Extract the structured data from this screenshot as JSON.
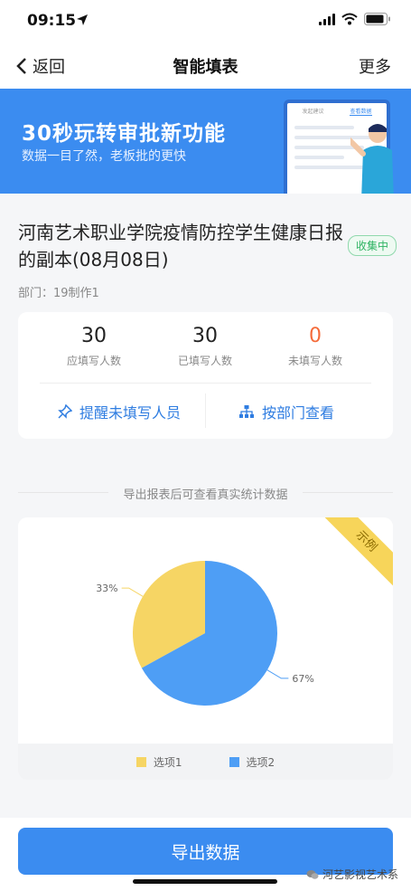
{
  "status": {
    "time": "09:15"
  },
  "nav": {
    "back": "返回",
    "title": "智能填表",
    "more": "更多"
  },
  "banner": {
    "title": "30秒玩转审批新功能",
    "subtitle": "数据一目了然，老板批的更快",
    "mock_tab1": "发起建议",
    "mock_tab2": "查看数据"
  },
  "form": {
    "title": "河南艺术职业学院疫情防控学生健康日报的副本(08月08日)",
    "status": "收集中",
    "dept": "部门：19制作1"
  },
  "stats": [
    {
      "value": "30",
      "label": "应填写人数"
    },
    {
      "value": "30",
      "label": "已填写人数"
    },
    {
      "value": "0",
      "label": "未填写人数"
    }
  ],
  "actions": {
    "remind": "提醒未填写人员",
    "by_dept": "按部门查看"
  },
  "export_hint": "导出报表后可查看真实统计数据",
  "sample_tag": "示例",
  "chart_data": {
    "type": "pie",
    "categories": [
      "选项1",
      "选项2"
    ],
    "values": [
      33,
      67
    ],
    "labels": [
      "33%",
      "67%"
    ],
    "colors": [
      "#f6d564",
      "#4e9ef5"
    ]
  },
  "export_button": "导出数据",
  "watermark": "河艺影视艺术系",
  "colors": {
    "accent": "#3b8cf0",
    "warning": "#f56b3a",
    "success": "#2fb363"
  }
}
